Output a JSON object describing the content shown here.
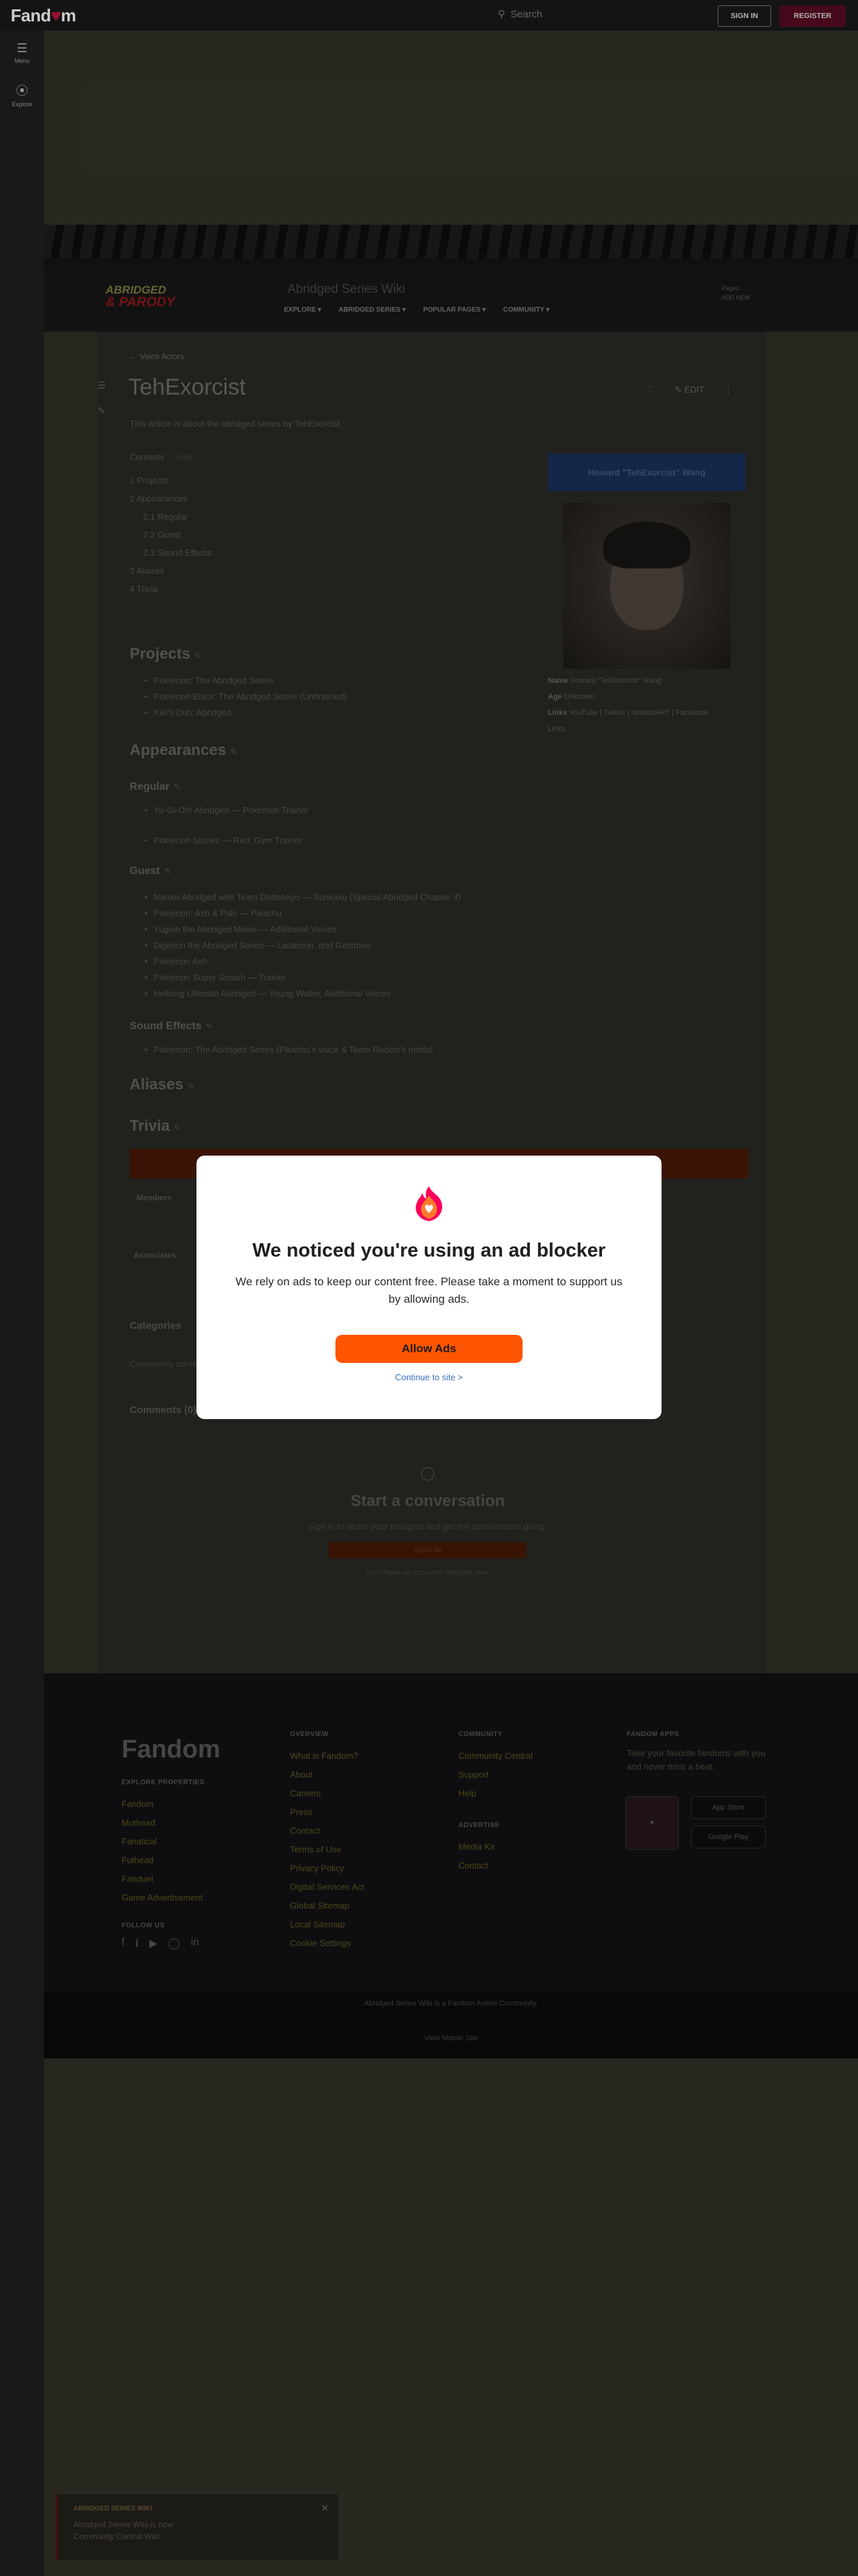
{
  "global_nav": {
    "logo": "Fandom",
    "search_placeholder": "Search",
    "sign_in": "SIGN IN",
    "register": "REGISTER"
  },
  "side_rail": {
    "menu_label": "Menu",
    "explore_label": "Explore"
  },
  "wiki_header": {
    "logo_line1": "ABRIDGED",
    "logo_line2": "& PARODY",
    "wiki_name": "Abridged Series Wiki",
    "nav": [
      "EXPLORE",
      "ABRIDGED SERIES",
      "POPULAR PAGES",
      "COMMUNITY"
    ],
    "tools_line1": "Pages",
    "tools_line2": "ADD NEW"
  },
  "article": {
    "breadcrumb": "Voice Actors",
    "title": "TehExorcist",
    "actions": {
      "share": "EDIT"
    },
    "subtitle": "This article is about the abridged series by TehExorcist",
    "toc": {
      "heading": "Contents",
      "hide": "hide",
      "items": [
        {
          "num": "1",
          "label": "Projects",
          "sub": false
        },
        {
          "num": "2",
          "label": "Appearances",
          "sub": false
        },
        {
          "num": "2.1",
          "label": "Regular",
          "sub": true
        },
        {
          "num": "2.2",
          "label": "Guest",
          "sub": true
        },
        {
          "num": "2.3",
          "label": "Sound Effects",
          "sub": true
        },
        {
          "num": "3",
          "label": "Aliases",
          "sub": false
        },
        {
          "num": "4",
          "label": "Trivia",
          "sub": false
        }
      ]
    },
    "infobox": {
      "title": "Howard \"TehExorcist\" Wang",
      "photo_icon": "portrait-photo",
      "rows": [
        {
          "label": "Name",
          "value": "Howard \"TehExorcist\" Wang"
        },
        {
          "label": "Age",
          "value": "Unknown"
        },
        {
          "label": "Links",
          "value": "YouTube | Twitter | deviantART | Facebook"
        }
      ],
      "extra": "Links"
    },
    "sections": {
      "projects": "Projects",
      "projects_items": [
        "Pokémon: The Abridged Series",
        "Pokémon Black: The Abridged Series (Unfinished)",
        "Kiki's Dub: Abridged"
      ],
      "appearances": "Appearances",
      "regular": "Regular",
      "regular_items": [
        "Yu-Gi-Oh! Abridged — Pokémon Trainer",
        "Pokémon Stories — Red, Gym Trainer"
      ],
      "guest": "Guest",
      "guest_items": [
        "Naruto Abridged with Team Dattebayo — Sunkaku (Special Abridged Chapter 4)",
        "Pokémon: Ash & Pals — Pikachu",
        "Yugioh the Abridged Movie — Additional Voices",
        "Digimon the Abridged Series — Ladamon, and Gotsmon",
        "Pokémon Ash",
        "Pokémon Super Smash — Trainer",
        "Hellsing Ultimate Abridged — Young Walter, Additional Voices"
      ],
      "sound_effects": "Sound Effects",
      "sound_effects_items": [
        "Pokémon: The Abridged Series (Pikachu's voice & Team Rocket's motto)"
      ],
      "aliases": "Aliases",
      "trivia": "Trivia"
    },
    "navbox": {
      "members": "Members",
      "associates": "Associates"
    },
    "categories": "Categories",
    "category_chip": "Community content",
    "comments": "Comments (0)",
    "conversation": {
      "title": "Start a conversation",
      "body": "Sign in to share your thoughts and get the conversation going.",
      "button": "SIGN IN",
      "footer": "Don't have an account? Register now."
    }
  },
  "footer": {
    "logo": "Fandom",
    "explore_heading": "EXPLORE PROPERTIES",
    "explore_items": [
      "Fandom",
      "Muthead",
      "Fanatical",
      "Futhead",
      "Fanduel",
      "Game Advertisement"
    ],
    "overview_heading": "OVERVIEW",
    "overview_items": [
      "What is Fandom?",
      "About",
      "Careers",
      "Press",
      "Contact",
      "Terms of Use",
      "Privacy Policy",
      "Digital Services Act",
      "Global Sitemap",
      "Local Sitemap",
      "Cookie Settings"
    ],
    "community_heading": "COMMUNITY",
    "community_items": [
      "Community Central",
      "Support",
      "Help"
    ],
    "advertise_heading": "ADVERTISE",
    "advertise_items": [
      "Media Kit",
      "Contact"
    ],
    "apps_heading": "FANDOM APPS",
    "apps_body": "Take your favorite fandoms with you and never miss a beat.",
    "app_store": "App Store",
    "google_play": "Google Play",
    "follow_heading": "FOLLOW US",
    "bottom_line1": "Abridged Series Wiki is a Fandom Anime Community.",
    "bottom_line2": "View Mobile Site"
  },
  "toast": {
    "title": "ABRIDGED SERIES WIKI",
    "line1": "Abridged Series Wiki is now",
    "line2": "Community Central Wiki"
  },
  "modal": {
    "title": "We noticed you're using an ad blocker",
    "body": "We rely on ads to keep our content free. Please take a moment to support us by allowing ads.",
    "allow_button": "Allow Ads",
    "continue": "Continue to site >",
    "accent": "#ff5500",
    "icon": "fandom-heart-flame-icon"
  }
}
